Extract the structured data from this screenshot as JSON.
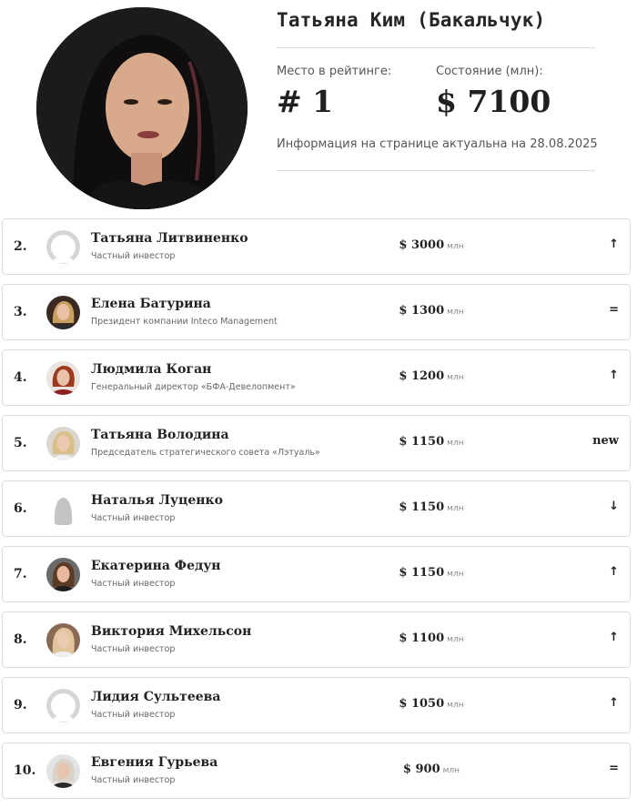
{
  "leader": {
    "name": "Татьяна Ким (Бакальчук)",
    "rank_label": "Место в рейтинге:",
    "rank_value": "# 1",
    "wealth_label": "Состояние (млн):",
    "wealth_value": "$ 7100",
    "info": "Информация на странице актуальна на 28.08.2025",
    "photo": "portrait-photo"
  },
  "colors": {
    "text": "#222222",
    "border": "#dedede",
    "muted": "#666666"
  },
  "list": [
    {
      "rank": "2.",
      "name": "Татьяна Литвиненко",
      "role": "Частный инвестор",
      "amount": "$ 3000",
      "unit": "млн",
      "trend": "↑",
      "avatar": "placeholder-icon"
    },
    {
      "rank": "3.",
      "name": "Елена Батурина",
      "role": "Президент компании Inteco Management",
      "amount": "$ 1300",
      "unit": "млн",
      "trend": "=",
      "avatar": "portrait"
    },
    {
      "rank": "4.",
      "name": "Людмила Коган",
      "role": "Генеральный директор «БФА-Девелопмент»",
      "amount": "$ 1200",
      "unit": "млн",
      "trend": "↑",
      "avatar": "portrait"
    },
    {
      "rank": "5.",
      "name": "Татьяна Володина",
      "role": "Председатель стратегического совета «Лэтуаль»",
      "amount": "$ 1150",
      "unit": "млн",
      "trend": "new",
      "avatar": "portrait"
    },
    {
      "rank": "6.",
      "name": "Наталья Луценко",
      "role": "Частный инвестор",
      "amount": "$ 1150",
      "unit": "млн",
      "trend": "↓",
      "avatar": "silhouette-icon"
    },
    {
      "rank": "7.",
      "name": "Екатерина Федун",
      "role": "Частный инвестор",
      "amount": "$ 1150",
      "unit": "млн",
      "trend": "↑",
      "avatar": "portrait"
    },
    {
      "rank": "8.",
      "name": "Виктория Михельсон",
      "role": "Частный инвестор",
      "amount": "$ 1100",
      "unit": "млн",
      "trend": "↑",
      "avatar": "portrait"
    },
    {
      "rank": "9.",
      "name": "Лидия Сультеева",
      "role": "Частный инвестор",
      "amount": "$ 1050",
      "unit": "млн",
      "trend": "↑",
      "avatar": "placeholder-icon"
    },
    {
      "rank": "10.",
      "name": "Евгения Гурьева",
      "role": "Частный инвестор",
      "amount": "$ 900",
      "unit": "млн",
      "trend": "=",
      "avatar": "portrait"
    }
  ]
}
